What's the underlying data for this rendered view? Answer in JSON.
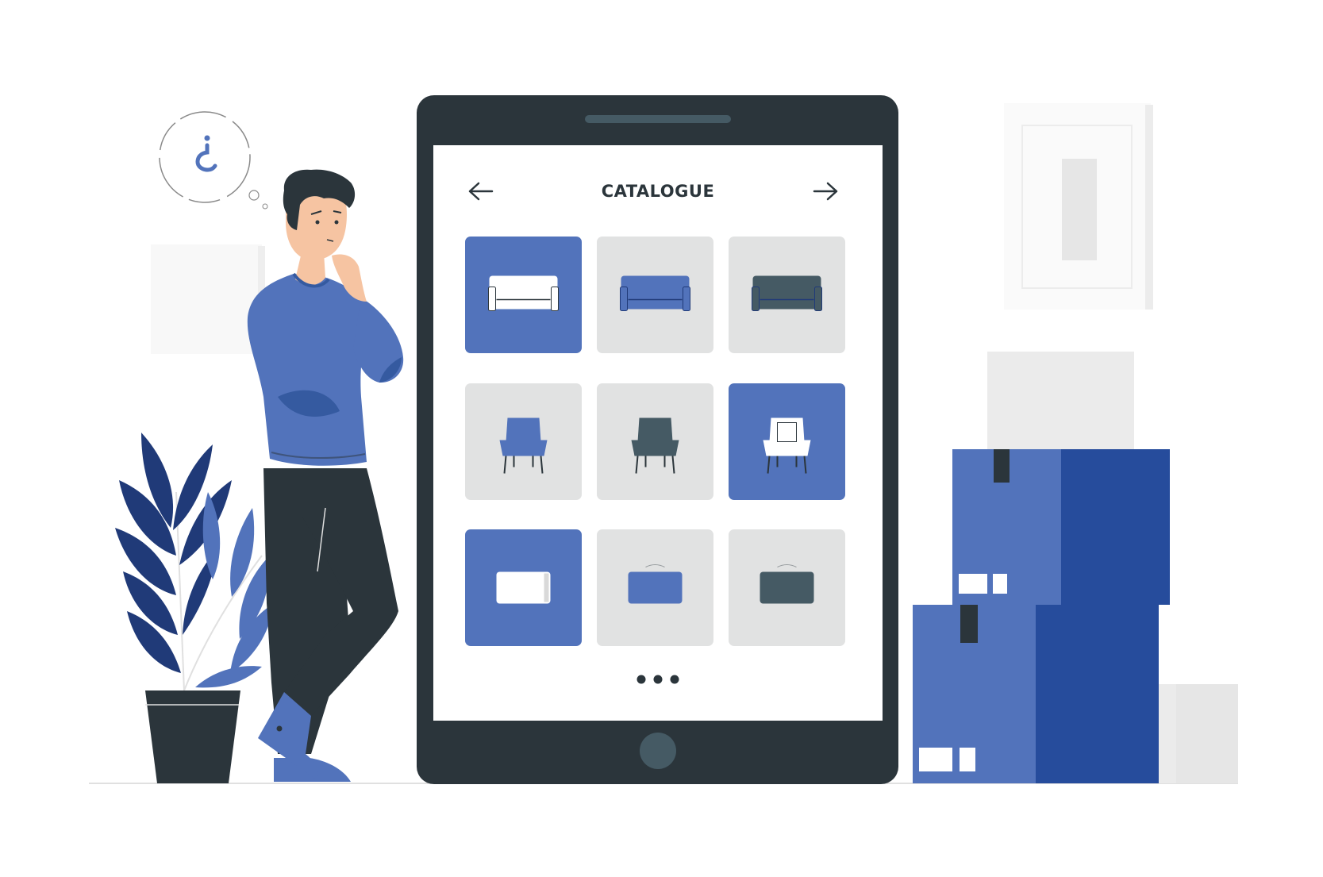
{
  "screen": {
    "title": "CATALOGUE"
  },
  "icons": {
    "prev": "arrow-left-icon",
    "next": "arrow-right-icon",
    "more": "ellipsis-icon",
    "home": "home-button-icon",
    "thought": "inverted-question-mark-icon"
  },
  "catalogue": {
    "rows": [
      {
        "kind": "sofa",
        "tiles": [
          {
            "bg": "#5273bb",
            "item": "#ffffff"
          },
          {
            "bg": "#e1e2e2",
            "item": "#5273bb"
          },
          {
            "bg": "#e1e2e2",
            "item": "#455a64"
          }
        ]
      },
      {
        "kind": "armchair",
        "tiles": [
          {
            "bg": "#e1e2e2",
            "item": "#5273bb"
          },
          {
            "bg": "#e1e2e2",
            "item": "#455a64"
          },
          {
            "bg": "#5273bb",
            "item": "#ffffff"
          }
        ]
      },
      {
        "kind": "ottoman",
        "tiles": [
          {
            "bg": "#5273bb",
            "item": "#ffffff"
          },
          {
            "bg": "#e1e2e2",
            "item": "#5273bb"
          },
          {
            "bg": "#e1e2e2",
            "item": "#455a64"
          }
        ]
      }
    ]
  },
  "colors": {
    "primary": "#5273bb",
    "dark_blue": "#264c9c",
    "navy": "#203a78",
    "device": "#2b353b",
    "tile_gray": "#e1e2e2",
    "dark_gray": "#455a64",
    "skin": "#f6c4a2"
  }
}
